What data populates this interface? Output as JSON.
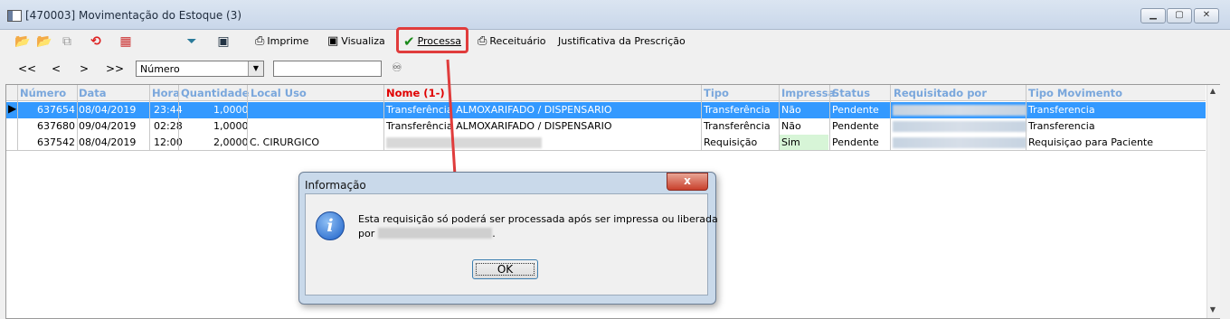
{
  "window": {
    "title": "[470003]  Movimentação do Estoque (3)",
    "min": "▁",
    "max": "▢",
    "close": "✕"
  },
  "toolbar": {
    "imprime": "Imprime",
    "visualiza": "Visualiza",
    "processa": "Processa",
    "receituario": "Receituário",
    "justificativa": "Justificativa da Prescrição",
    "icons": [
      "open-folder-icon",
      "open-folder-2-icon",
      "copy-icon",
      "refresh-icon",
      "calendar-icon",
      "filter-icon",
      "monitor-icon"
    ]
  },
  "nav": {
    "first": "<<",
    "prev": "<",
    "next": ">",
    "last": ">>",
    "search_field": "Número",
    "search_value": ""
  },
  "grid": {
    "columns": [
      "Número",
      "Data",
      "Hora",
      "Quantidade",
      "Local Uso",
      "Nome (1-)",
      "Tipo",
      "Impressa",
      "Status",
      "Requisitado por",
      "Tipo Movimento"
    ],
    "rows": [
      {
        "numero": "637654",
        "data": "08/04/2019",
        "hora": "23:44",
        "quantidade": "1,0000",
        "local": "",
        "nome": "Transferência ALMOXARIFADO / DISPENSARIO",
        "tipo": "Transferência",
        "impressa": "Não",
        "status": "Pendente",
        "requisitado": "",
        "movimento": "Transferencia"
      },
      {
        "numero": "637680",
        "data": "09/04/2019",
        "hora": "02:28",
        "quantidade": "1,0000",
        "local": "",
        "nome": "Transferência ALMOXARIFADO / DISPENSARIO",
        "tipo": "Transferência",
        "impressa": "Não",
        "status": "Pendente",
        "requisitado": "",
        "movimento": "Transferencia"
      },
      {
        "numero": "637542",
        "data": "08/04/2019",
        "hora": "12:00",
        "quantidade": "2,0000",
        "local": "C. CIRURGICO",
        "nome": "",
        "tipo": "Requisição",
        "impressa": "Sim",
        "status": "Pendente",
        "requisitado": "",
        "movimento": "Requisiçao para Paciente"
      }
    ]
  },
  "dialog": {
    "title": "Informação",
    "close": "x",
    "message_line1": "Esta requisição só poderá ser processada após ser impressa ou liberada",
    "message_line2_prefix": "por",
    "message_line2_suffix": ".",
    "ok": "OK"
  },
  "colors": {
    "selection": "#3399ff",
    "highlight_box": "#e03c3c",
    "header_text": "#7aa7dc",
    "sort_header": "#e00000"
  }
}
